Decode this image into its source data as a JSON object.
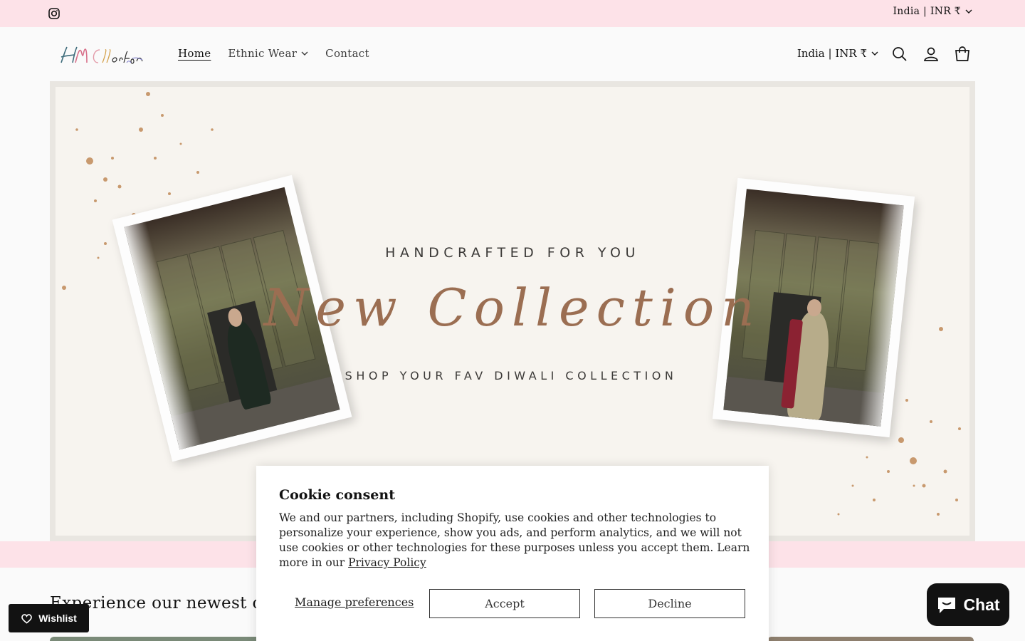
{
  "announcement": {
    "instagram_icon": "instagram-icon",
    "locale_selector": "India | INR ₹"
  },
  "header": {
    "logo_text": "HM Collection",
    "nav": [
      {
        "label": "Home",
        "active": true
      },
      {
        "label": "Ethnic Wear",
        "dropdown": true
      },
      {
        "label": "Contact"
      }
    ],
    "locale_selector": "India | INR ₹",
    "icons": [
      "search-icon",
      "account-icon",
      "cart-icon"
    ]
  },
  "hero": {
    "tagline_top": "HANDCRAFTED FOR YOU",
    "script_title": "New Collection",
    "tagline_bottom": "SHOP YOUR FAV DIWALI COLLECTION",
    "accent_color": "#9b6e52"
  },
  "section": {
    "title": "Experience our newest offer"
  },
  "cookie": {
    "title": "Cookie consent",
    "body": "We and our partners, including Shopify, use cookies and other technologies to personalize your experience, show you ads, and perform analytics, and we will not use cookies or other technologies for these purposes unless you accept them. Learn more in our",
    "privacy_link": "Privacy Policy",
    "manage_label": "Manage preferences",
    "accept_label": "Accept",
    "decline_label": "Decline"
  },
  "wishlist": {
    "label": "Wishlist"
  },
  "chat": {
    "label": "Chat"
  },
  "colors": {
    "pink_band": "#fde2e8",
    "dark": "#121212"
  }
}
